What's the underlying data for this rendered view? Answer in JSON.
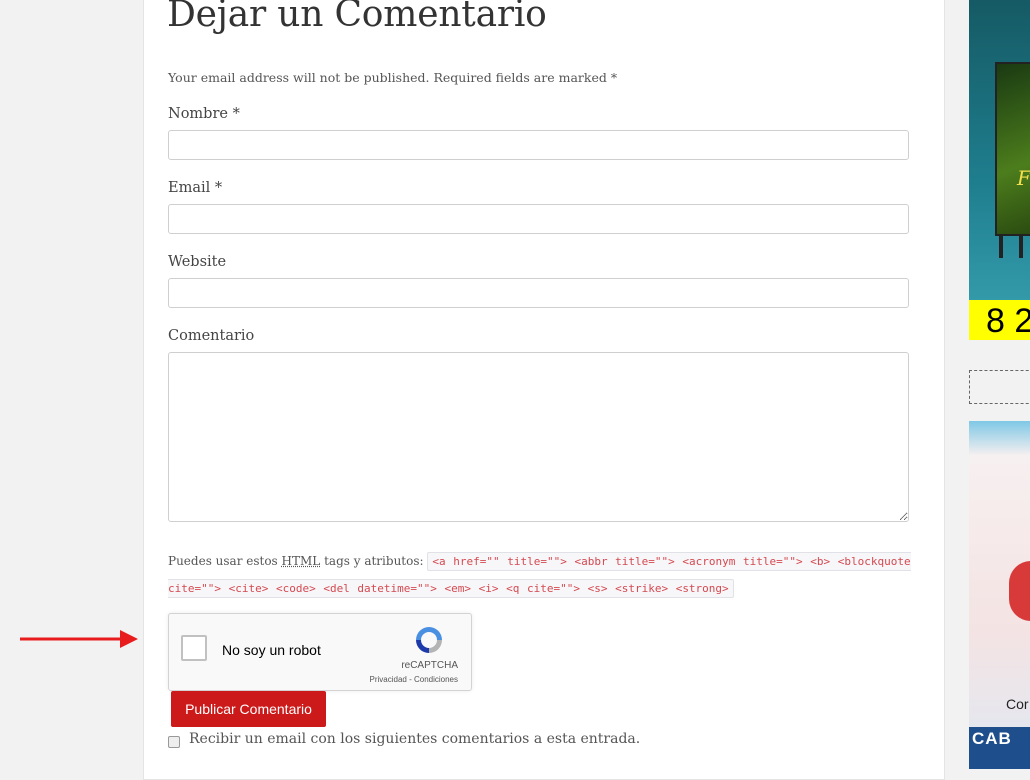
{
  "form": {
    "title": "Dejar un Comentario",
    "note": "Your email address will not be published. Required fields are marked *",
    "name_label": "Nombre *",
    "email_label": "Email *",
    "website_label": "Website",
    "comment_label": "Comentario",
    "name_value": "",
    "email_value": "",
    "website_value": "",
    "allowed_tags": {
      "prefix": "Puedes usar estos",
      "abbr": "HTML",
      "suffix": "tags y atributos:",
      "code": "<a href=\"\" title=\"\"> <abbr title=\"\"> <acronym title=\"\"> <b> <blockquote cite=\"\"> <cite> <code> <del datetime=\"\"> <em> <i> <q cite=\"\"> <s> <strike> <strong>"
    },
    "submit_label": "Publicar Comentario",
    "subscribe_label": "Recibir un email con los siguientes comentarios a esta entrada."
  },
  "captcha": {
    "label": "No soy un robot",
    "brand": "reCAPTCHA",
    "links": "Privacidad - Condiciones"
  },
  "annotation": {
    "arrow_color": "#e81c1c"
  },
  "sidebar": {
    "ad1_number": "8 2",
    "ad1_letter": "F",
    "ad2_text": "Cor",
    "ad2_bar": "CAB"
  },
  "colors": {
    "submit_bg": "#cc1919",
    "code_text": "#d44950"
  }
}
